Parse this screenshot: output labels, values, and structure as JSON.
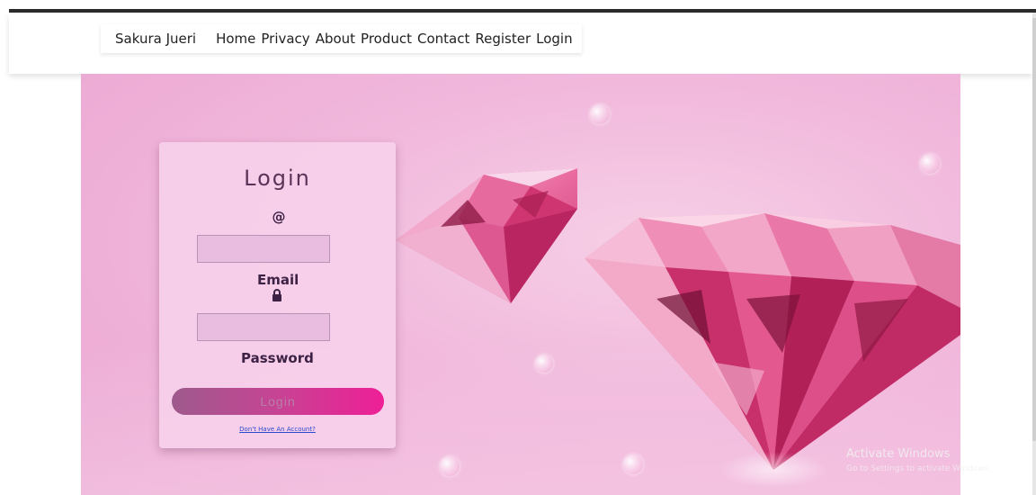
{
  "nav": {
    "brand": "Sakura Jueri",
    "links": [
      "Home",
      "Privacy",
      "About",
      "Product",
      "Contact",
      "Register",
      "Login"
    ]
  },
  "login": {
    "title": "Login",
    "email_icon": "@",
    "email_label": "Email",
    "email_value": "",
    "lock_icon": "lock-icon",
    "password_label": "Password",
    "password_value": "",
    "submit_label": "Login",
    "signup_link": "Don't Have An Account?"
  },
  "watermark": {
    "line1": "Activate Windows",
    "line2": "Go to Settings to activate Windows."
  },
  "colors": {
    "hero_pink": "#eeaed6",
    "card_pink": "#f7d0ea",
    "button_gradient_start": "#9e5a8c",
    "button_gradient_end": "#ee1f96",
    "label_color": "#3d2245",
    "link_blue": "#2a4ad0",
    "diamond_pink": "#e8578f"
  }
}
